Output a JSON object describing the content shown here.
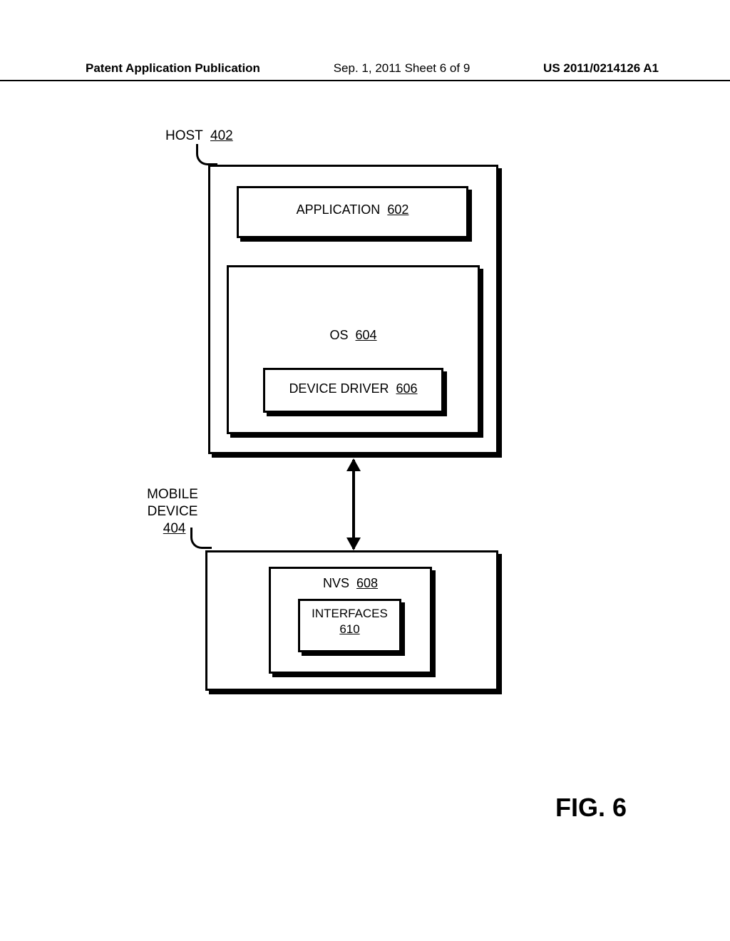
{
  "header": {
    "left": "Patent Application Publication",
    "mid": "Sep. 1, 2011   Sheet 6 of 9",
    "right": "US 2011/0214126 A1"
  },
  "host": {
    "label": "HOST",
    "ref": "402",
    "app": {
      "label": "APPLICATION",
      "ref": "602"
    },
    "os": {
      "label": "OS",
      "ref": "604"
    },
    "device_driver": {
      "label": "DEVICE DRIVER",
      "ref": "606"
    }
  },
  "mobile_device": {
    "label": "MOBILE DEVICE",
    "ref": "404",
    "nvs": {
      "label": "NVS",
      "ref": "608"
    },
    "interfaces": {
      "label": "INTERFACES",
      "ref": "610"
    }
  },
  "figure": {
    "label": "FIG. 6"
  }
}
